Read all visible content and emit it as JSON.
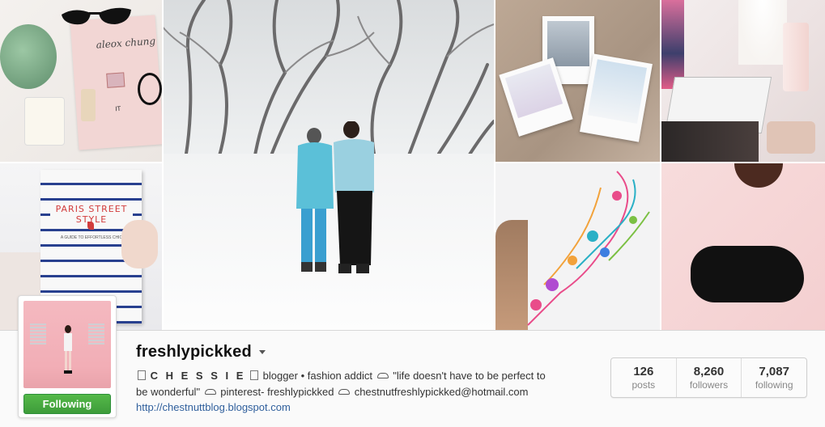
{
  "photo_grid": {
    "items": [
      {
        "id": "flatlay",
        "caption_text": "aleox chung",
        "caption_text2": "IT"
      },
      {
        "id": "paris-book",
        "caption_text": "PARIS STREET STYLE",
        "caption_text2": "A GUIDE TO EFFORTLESS CHIC"
      },
      {
        "id": "snow-walk"
      },
      {
        "id": "polaroids"
      },
      {
        "id": "desk"
      },
      {
        "id": "art"
      },
      {
        "id": "sweater"
      }
    ]
  },
  "profile": {
    "username": "freshlypickked",
    "follow_button": "Following",
    "bio": {
      "line1_pre": "",
      "display_name": "C H E S S I E",
      "line1_post": " blogger • fashion addict ",
      "quote": "\"life doesn't have to be perfect to be wonderful\" ",
      "pinterest": "pinterest- freshlypickked ",
      "email": "chestnutfreshlypickked@hotmail.com"
    },
    "link": "http://chestnuttblog.blogspot.com",
    "stats": {
      "posts": {
        "value": "126",
        "label": "posts"
      },
      "followers": {
        "value": "8,260",
        "label": "followers"
      },
      "following": {
        "value": "7,087",
        "label": "following"
      }
    }
  },
  "colors": {
    "follow_green": "#4caf46",
    "link_blue": "#2f5f9c",
    "username": "#111111"
  },
  "icons": {
    "caret": "chevron-down-icon",
    "bio_cloud": "cloud-icon",
    "bio_box": "unknown-glyph-icon"
  }
}
